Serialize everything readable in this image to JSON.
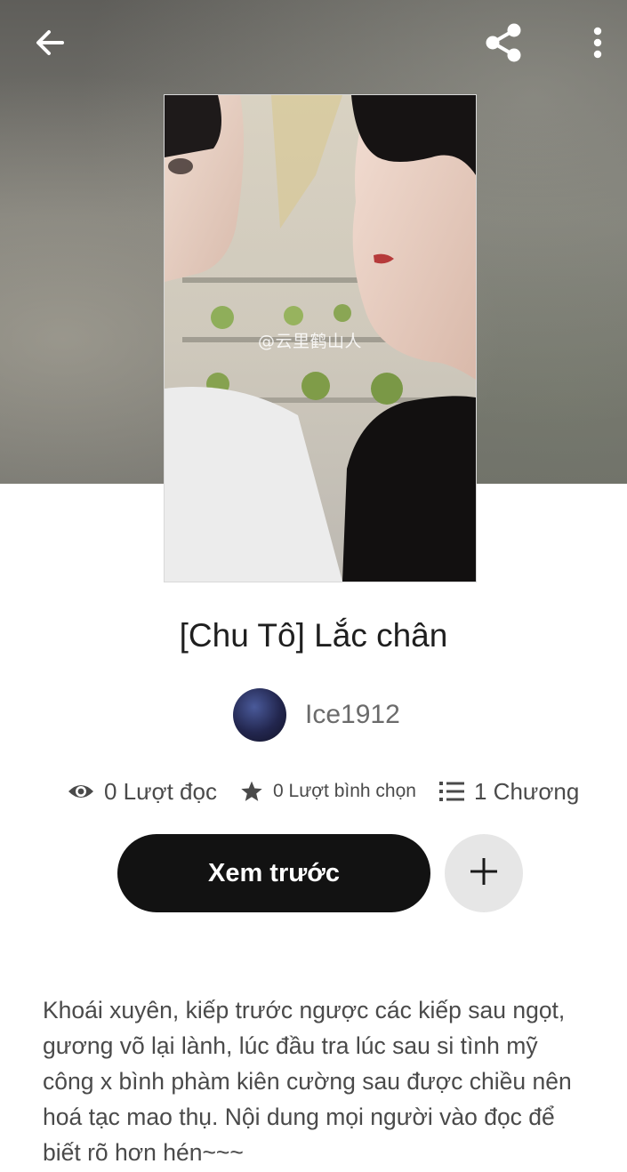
{
  "story": {
    "title": "[Chu Tô] Lắc chân",
    "author": "Ice1912",
    "cover_watermark": "@云里鹤山人",
    "description": "Khoái xuyên, kiếp trước ngược các kiếp sau ngọt, gương võ lại lành, lúc đầu tra lúc sau si tình mỹ công x bình phàm kiên cường sau được chiều nên hoá tạc mao thụ. Nội dung mọi người vào đọc để biết rõ hơn hén~~~"
  },
  "stats": {
    "reads": "0 Lượt đọc",
    "votes": "0 Lượt bình chọn",
    "chapters": "1 Chương"
  },
  "actions": {
    "read_label": "Xem trước"
  },
  "icons": {
    "back": "arrow-left-icon",
    "share": "share-icon",
    "more": "more-vertical-icon",
    "reads": "eye-icon",
    "votes": "star-icon",
    "chapters": "list-icon",
    "add": "plus-icon"
  },
  "colors": {
    "primary_button": "#121212",
    "secondary_button": "#e6e6e6",
    "text_muted": "#4a4a4a"
  }
}
